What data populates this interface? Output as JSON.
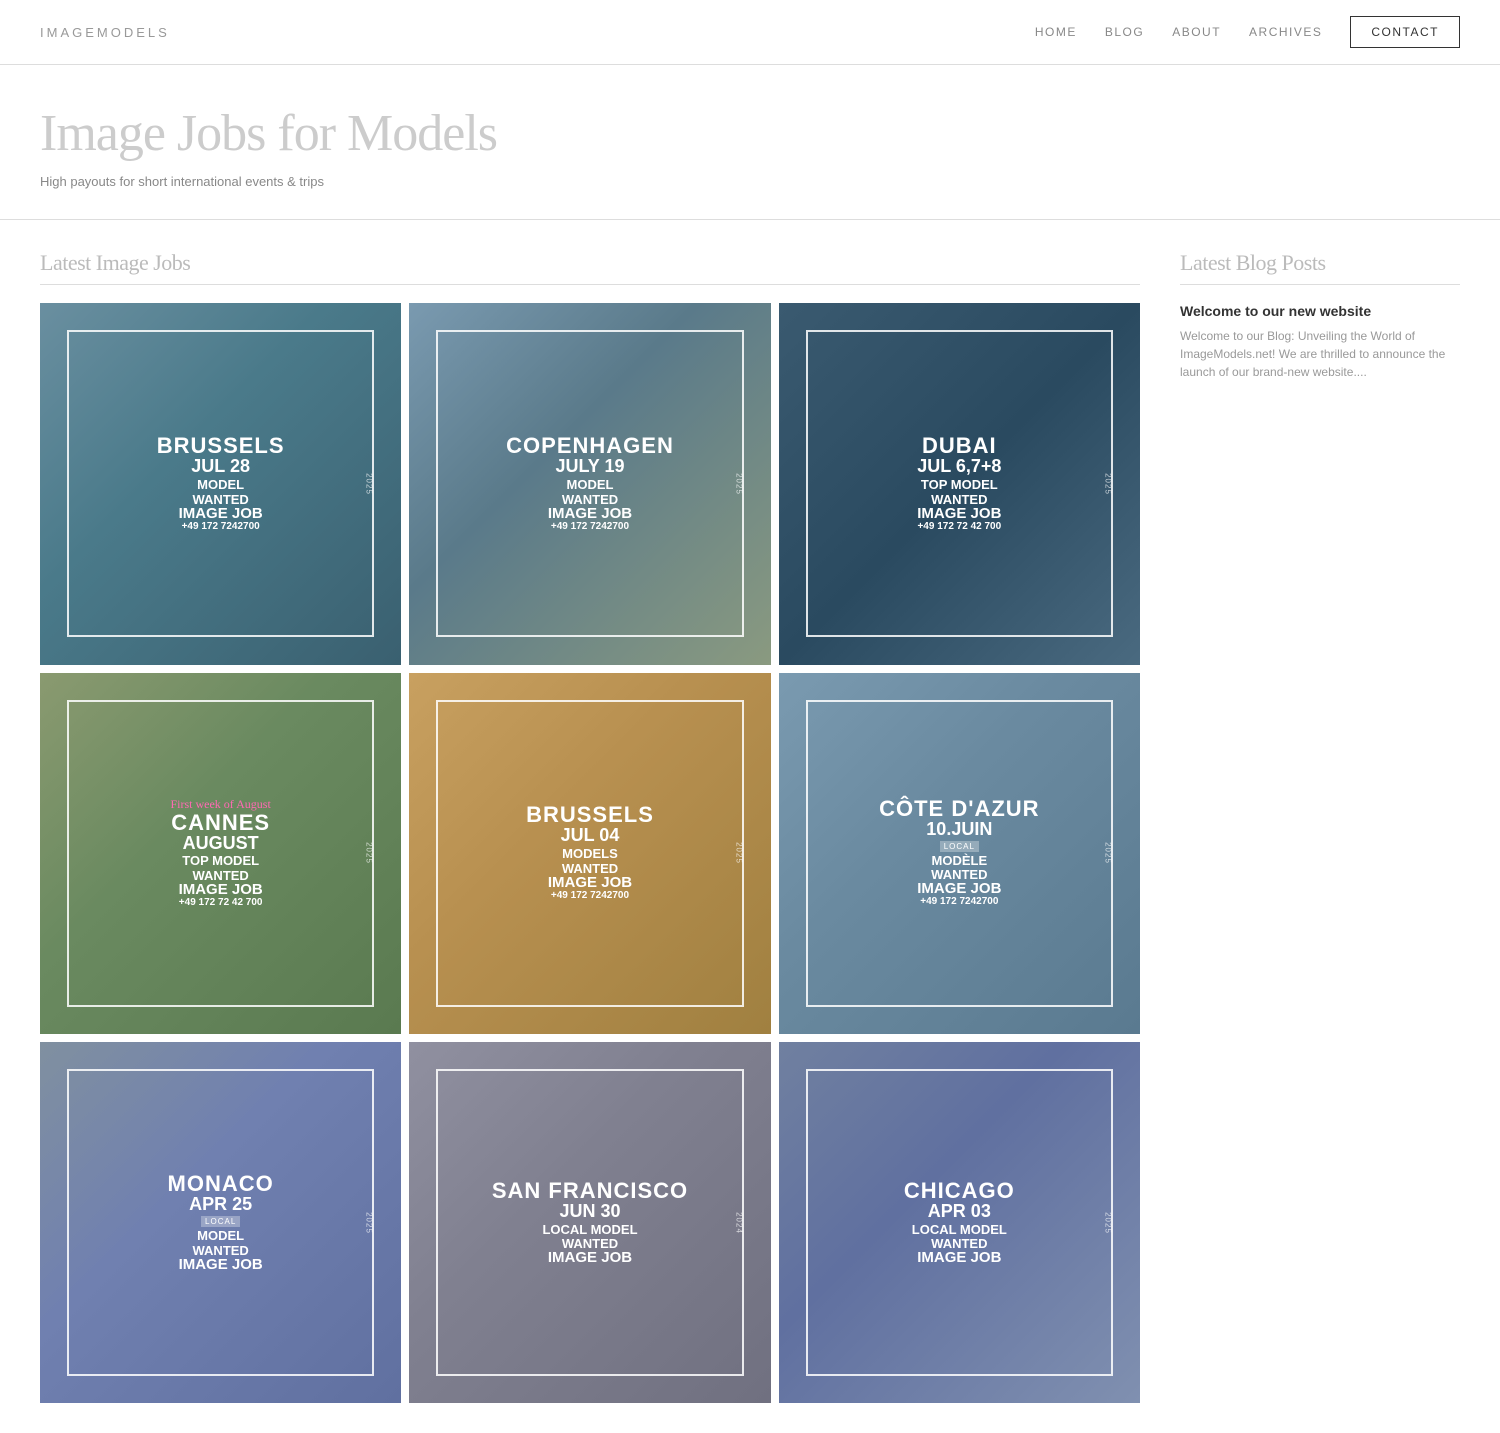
{
  "nav": {
    "logo": "IMAGEMODELS",
    "links": [
      {
        "label": "HOME",
        "name": "nav-home"
      },
      {
        "label": "BLOG",
        "name": "nav-blog"
      },
      {
        "label": "ABOUT",
        "name": "nav-about"
      },
      {
        "label": "ARCHIVES",
        "name": "nav-archives"
      }
    ],
    "contact_label": "CONTACT"
  },
  "hero": {
    "title": "Image Jobs for Models",
    "subtitle": "High payouts for short international events & trips"
  },
  "jobs_section": {
    "title": "Latest Image Jobs"
  },
  "jobs": [
    {
      "city": "BRUSSELS",
      "date": "JUL 28",
      "year": "2025",
      "type": "MODEL",
      "wanted": "WANTED",
      "label": "IMAGE JOB",
      "phone": "+49 172 7242700",
      "bg": "bg-brussels1",
      "extra": "",
      "local": false
    },
    {
      "city": "COPENHAGEN",
      "date": "JULY 19",
      "year": "2025",
      "type": "MODEL",
      "wanted": "WANTED",
      "label": "IMAGE JOB",
      "phone": "+49 172 7242700",
      "bg": "bg-copenhagen",
      "extra": "",
      "local": false
    },
    {
      "city": "DUBAI",
      "date": "JUL 6,7+8",
      "year": "2025",
      "type": "TOP MODEL",
      "wanted": "WANTED",
      "label": "IMAGE JOB",
      "phone": "+49 172 72 42 700",
      "bg": "bg-dubai",
      "extra": "",
      "local": false
    },
    {
      "city": "CANNES",
      "date": "AUGUST",
      "year": "2025",
      "type": "TOP MODEL",
      "wanted": "WANTED",
      "label": "IMAGE JOB",
      "phone": "+49 172 72 42 700",
      "bg": "bg-cannes",
      "extra": "First week of August",
      "local": false,
      "pink": true
    },
    {
      "city": "BRUSSELS",
      "date": "JUL 04",
      "year": "2025",
      "type": "MODELS",
      "wanted": "WANTED",
      "label": "IMAGE JOB",
      "phone": "+49 172 7242700",
      "bg": "bg-brussels2",
      "extra": "",
      "local": false
    },
    {
      "city": "CÔTE D'AZUR",
      "date": "10.JUIN",
      "year": "2025",
      "type": "MODÈLE",
      "wanted": "WANTED",
      "label": "IMAGE JOB",
      "phone": "+49 172 7242700",
      "bg": "bg-cote",
      "extra": "",
      "local": true
    },
    {
      "city": "MONACO",
      "date": "APR 25",
      "year": "2025",
      "type": "MODEL",
      "wanted": "WANTED",
      "label": "IMAGE JOB",
      "phone": "",
      "bg": "bg-monaco",
      "extra": "",
      "local": true
    },
    {
      "city": "SAN FRANCISCO",
      "date": "JUN 30",
      "year": "2024",
      "type": "LOCAL MODEL",
      "wanted": "WANTED",
      "label": "IMAGE JOB",
      "phone": "",
      "bg": "bg-sf",
      "extra": "",
      "local": false
    },
    {
      "city": "CHICAGO",
      "date": "APR 03",
      "year": "2025",
      "type": "LOCAL MODEL",
      "wanted": "WANTED",
      "label": "IMAGE JOB",
      "phone": "",
      "bg": "bg-chicago",
      "extra": "",
      "local": false
    }
  ],
  "blog_section": {
    "title": "Latest Blog Posts"
  },
  "blog_posts": [
    {
      "title": "Welcome to our new website",
      "excerpt": "Welcome to our Blog: Unveiling the World of ImageModels.net! We are thrilled to announce the launch of our brand-new website...."
    }
  ]
}
